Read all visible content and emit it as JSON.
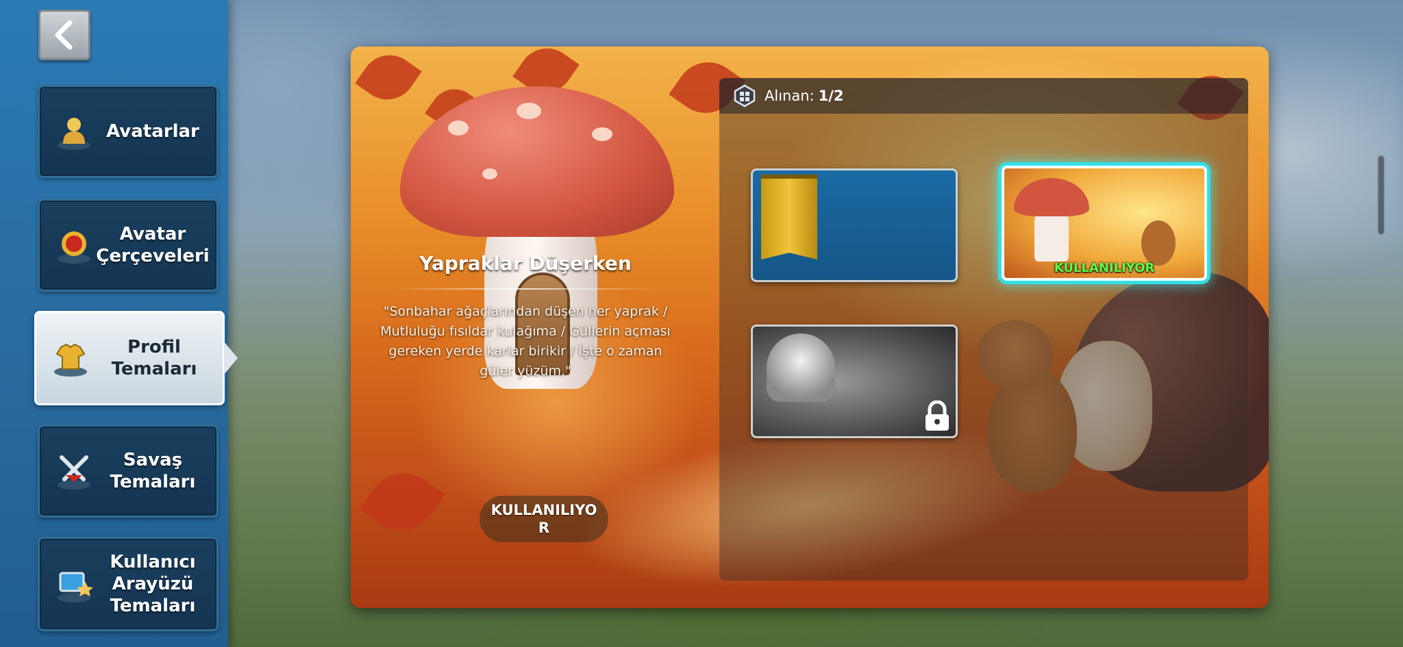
{
  "sidebar": {
    "items": [
      {
        "label": "Avatarlar"
      },
      {
        "label": "Avatar Çerçeveleri"
      },
      {
        "label": "Profil Temaları"
      },
      {
        "label": "Savaş Temaları"
      },
      {
        "label": "Kullanıcı Arayüzü Temaları"
      }
    ]
  },
  "theme": {
    "title": "Yapraklar Düşerken",
    "description": "\"Sonbahar ağaçlarından düşen her yaprak / Mutluluğu fısıldar kulağıma / Güllerin açması gereken yerde karlar birikir / İşte o zaman güler yüzüm.\"",
    "use_button": "KULLANILIYOR"
  },
  "collection": {
    "label": "Alınan:",
    "count": "1/2",
    "cards": [
      {
        "name": "default-theme",
        "status": ""
      },
      {
        "name": "autumn-theme",
        "status": "KULLANILIYOR"
      },
      {
        "name": "shell-theme",
        "status": "locked"
      }
    ]
  },
  "colors": {
    "sidebar": "#2a6fa5",
    "selected_glow": "#33e0e8",
    "status_green": "#5cff4a"
  }
}
